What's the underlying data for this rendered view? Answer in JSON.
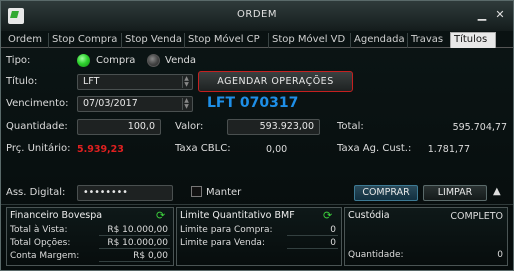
{
  "window": {
    "title": "ORDEM",
    "minimize_icon": "minimize-icon",
    "close_icon": "close-icon"
  },
  "tabs": [
    {
      "label": "Ordem"
    },
    {
      "label": "Stop Compra"
    },
    {
      "label": "Stop Venda"
    },
    {
      "label": "Stop Móvel CP"
    },
    {
      "label": "Stop Móvel VD"
    },
    {
      "label": "Agendada"
    },
    {
      "label": "Travas"
    },
    {
      "label": "Títulos",
      "active": true
    }
  ],
  "form": {
    "tipo_label": "Tipo:",
    "compra_label": "Compra",
    "venda_label": "Venda",
    "compra_selected": true,
    "titulo_label": "Título:",
    "titulo_value": "LFT",
    "agendar_label": "AGENDAR OPERAÇÕES",
    "vencimento_label": "Vencimento:",
    "vencimento_value": "07/03/2017",
    "ticker": "LFT 070317",
    "quantidade_label": "Quantidade:",
    "quantidade_value": "100,0",
    "valor_label": "Valor:",
    "valor_value": "593.923,00",
    "total_label": "Total:",
    "total_value": "595.704,77",
    "preco_label": "Prç. Unitário:",
    "preco_value": "5.939,23",
    "taxa_cblc_label": "Taxa CBLC:",
    "taxa_cblc_value": "0,00",
    "taxa_ag_label": "Taxa Ag. Cust.:",
    "taxa_ag_value": "1.781,77",
    "assinatura_label": "Ass. Digital:",
    "assinatura_value": "••••••••",
    "manter_label": "Manter",
    "comprar_label": "COMPRAR",
    "limpar_label": "LIMPAR",
    "collapse_icon": "triangle-up-icon"
  },
  "colors": {
    "preco_red": "#e02020",
    "ticker_blue": "#1e8fe8",
    "radio_green": "#2fd22f",
    "agendar_border": "#c42020"
  },
  "panels": {
    "financeiro": {
      "title": "Financeiro Bovespa",
      "rows": [
        {
          "label": "Total à Vista:",
          "value": "R$ 10.000,00"
        },
        {
          "label": "Total Opções:",
          "value": "R$ 10.000,00"
        },
        {
          "label": "Conta Margem:",
          "value": "R$ 0,00"
        }
      ]
    },
    "limite": {
      "title": "Limite Quantitativo BMF",
      "rows": [
        {
          "label": "Limite para Compra:",
          "value": "0"
        },
        {
          "label": "Limite para Venda:",
          "value": "0"
        }
      ]
    },
    "custodia": {
      "title": "Custódia",
      "status": "COMPLETO",
      "quantidade_label": "Quantidade:",
      "quantidade_value": "0"
    }
  }
}
